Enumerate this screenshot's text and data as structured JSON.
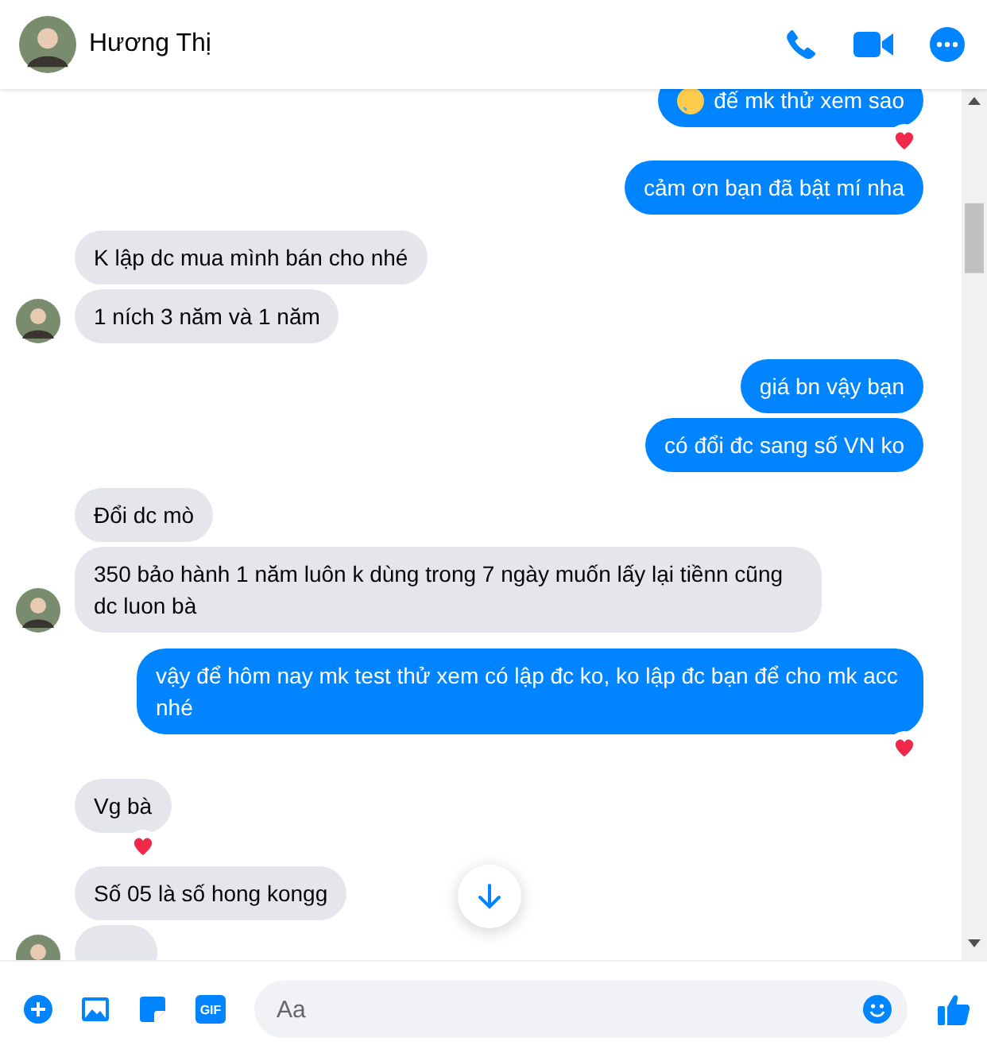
{
  "header": {
    "name": "Hương Thị"
  },
  "groups": [
    {
      "kind": "outgoing",
      "messages": [
        {
          "kind": "text",
          "text": "đế mk thử xem sao",
          "emoji": true,
          "reaction": true
        },
        {
          "kind": "text",
          "text": "cảm ơn bạn đã bật mí nha",
          "emoji": false,
          "reaction": false
        }
      ]
    },
    {
      "kind": "incoming",
      "messages": [
        {
          "kind": "text",
          "text": "K lập dc mua mình bán cho nhé",
          "emoji": false,
          "reaction": false
        },
        {
          "kind": "text",
          "text": "1 ních 3 năm và 1 năm",
          "emoji": false,
          "reaction": false
        }
      ]
    },
    {
      "kind": "outgoing",
      "messages": [
        {
          "kind": "text",
          "text": "giá bn vậy bạn",
          "emoji": false,
          "reaction": false
        },
        {
          "kind": "text",
          "text": "có đổi đc sang số VN ko",
          "emoji": false,
          "reaction": false
        }
      ]
    },
    {
      "kind": "incoming",
      "messages": [
        {
          "kind": "text",
          "text": "Đổi dc mò",
          "emoji": false,
          "reaction": false
        },
        {
          "kind": "text",
          "text": "350 bảo hành 1 năm luôn k dùng trong 7 ngày muốn lấy lại tiềnn cũng dc luon bà",
          "emoji": false,
          "reaction": false
        }
      ]
    },
    {
      "kind": "outgoing",
      "messages": [
        {
          "kind": "text",
          "text": "vậy để hôm nay mk test thử xem có lập đc ko, ko lập đc bạn để cho mk acc nhé",
          "emoji": false,
          "reaction": true
        }
      ]
    },
    {
      "kind": "incoming",
      "messages": [
        {
          "kind": "text",
          "text": "Vg bà",
          "emoji": false,
          "reaction": true
        },
        {
          "kind": "text",
          "text": "Số 05 là số hong kongg",
          "emoji": false,
          "reaction": false
        },
        {
          "kind": "cut"
        }
      ]
    }
  ],
  "composer": {
    "gif_label": "GIF",
    "placeholder": "Aa"
  }
}
